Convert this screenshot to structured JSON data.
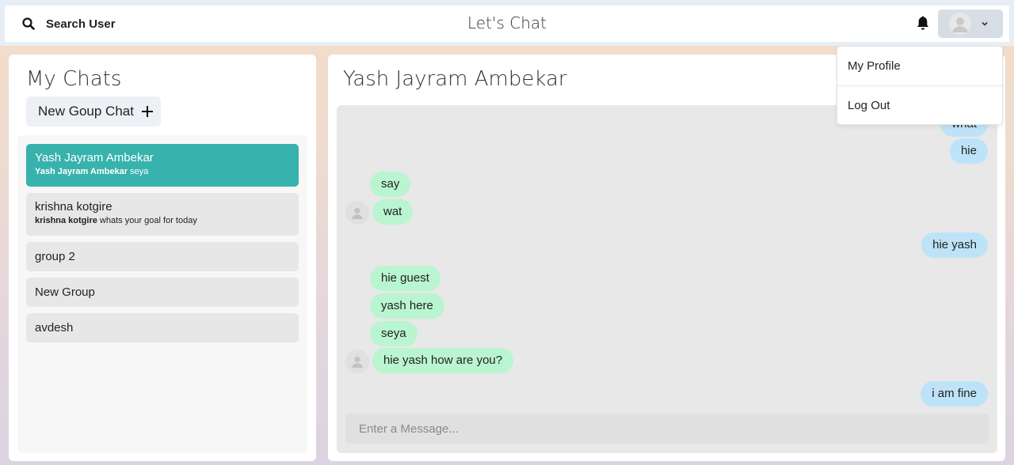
{
  "header": {
    "search_label": "Search User",
    "app_title": "Let's Chat"
  },
  "profile_menu": {
    "items": [
      {
        "label": "My Profile"
      },
      {
        "label": "Log Out"
      }
    ]
  },
  "sidebar": {
    "title": "My Chats",
    "new_group_label": "New Goup Chat",
    "chats": [
      {
        "name": "Yash Jayram Ambekar",
        "sender": "Yash Jayram Ambekar",
        "preview": " seya",
        "active": true
      },
      {
        "name": "krishna kotgire",
        "sender": "krishna kotgire",
        "preview": " whats your goal for today",
        "active": false
      },
      {
        "name": "group 2"
      },
      {
        "name": "New Group"
      },
      {
        "name": "avdesh"
      }
    ]
  },
  "conversation": {
    "title": "Yash Jayram Ambekar",
    "messages": [
      {
        "text": "what",
        "type": "sent"
      },
      {
        "text": "hie",
        "type": "sent"
      },
      {
        "text": "say",
        "type": "recv"
      },
      {
        "text": "wat",
        "type": "recv"
      },
      {
        "text": "hie yash",
        "type": "sent"
      },
      {
        "text": "hie guest",
        "type": "recv"
      },
      {
        "text": "yash here",
        "type": "recv"
      },
      {
        "text": "seya",
        "type": "recv"
      },
      {
        "text": "hie yash how are you?",
        "type": "recv"
      },
      {
        "text": "i am fine",
        "type": "sent"
      }
    ],
    "input_placeholder": "Enter a Message..."
  },
  "colors": {
    "active_chat": "#38b2ac",
    "sent_bubble": "#bee3f8",
    "recv_bubble": "#b9f5d0"
  }
}
